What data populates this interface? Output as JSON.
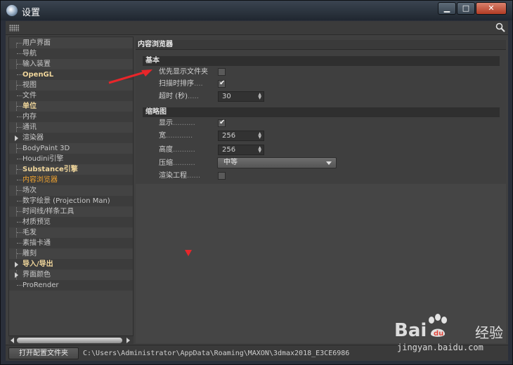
{
  "window": {
    "title": "设置"
  },
  "sidebar": {
    "items": [
      {
        "label": "用户界面",
        "bold": false,
        "selected": false,
        "expandable": false
      },
      {
        "label": "导航",
        "bold": false,
        "selected": false,
        "expandable": false
      },
      {
        "label": "输入装置",
        "bold": false,
        "selected": false,
        "expandable": false
      },
      {
        "label": "OpenGL",
        "bold": true,
        "selected": false,
        "expandable": false
      },
      {
        "label": "视图",
        "bold": false,
        "selected": false,
        "expandable": false
      },
      {
        "label": "文件",
        "bold": false,
        "selected": false,
        "expandable": false
      },
      {
        "label": "单位",
        "bold": true,
        "selected": false,
        "expandable": false
      },
      {
        "label": "内存",
        "bold": false,
        "selected": false,
        "expandable": false
      },
      {
        "label": "通讯",
        "bold": false,
        "selected": false,
        "expandable": false
      },
      {
        "label": "渲染器",
        "bold": false,
        "selected": false,
        "expandable": true
      },
      {
        "label": "BodyPaint 3D",
        "bold": false,
        "selected": false,
        "expandable": false
      },
      {
        "label": "Houdini引擎",
        "bold": false,
        "selected": false,
        "expandable": false
      },
      {
        "label": "Substance引擎",
        "bold": true,
        "selected": false,
        "expandable": false
      },
      {
        "label": "内容浏览器",
        "bold": false,
        "selected": true,
        "expandable": false
      },
      {
        "label": "场次",
        "bold": false,
        "selected": false,
        "expandable": false
      },
      {
        "label": "数字绘景 (Projection Man)",
        "bold": false,
        "selected": false,
        "expandable": false
      },
      {
        "label": "时间线/样条工具",
        "bold": false,
        "selected": false,
        "expandable": false
      },
      {
        "label": "材质预览",
        "bold": false,
        "selected": false,
        "expandable": false
      },
      {
        "label": "毛发",
        "bold": false,
        "selected": false,
        "expandable": false
      },
      {
        "label": "素描卡通",
        "bold": false,
        "selected": false,
        "expandable": false
      },
      {
        "label": "雕刻",
        "bold": false,
        "selected": false,
        "expandable": false
      },
      {
        "label": "导入/导出",
        "bold": true,
        "selected": false,
        "expandable": true
      },
      {
        "label": "界面颜色",
        "bold": false,
        "selected": false,
        "expandable": true
      },
      {
        "label": "ProRender",
        "bold": false,
        "selected": false,
        "expandable": false
      }
    ]
  },
  "main": {
    "panel_title": "内容浏览器",
    "basic": {
      "title": "基本",
      "show_folders_first": {
        "label": "优先显示文件夹",
        "checked": false
      },
      "sort_on_scan": {
        "label": "扫描时排序",
        "dots": "....",
        "checked": true
      },
      "timeout": {
        "label": "超时 (秒)",
        "dots": ".....",
        "value": "30"
      }
    },
    "thumbnail": {
      "title": "缩略图",
      "show": {
        "label": "显示",
        "dots": "..........",
        "checked": true
      },
      "width": {
        "label": "宽",
        "dots": "............",
        "value": "256"
      },
      "height": {
        "label": "高度",
        "dots": "..........",
        "value": "256"
      },
      "compression": {
        "label": "压缩",
        "dots": "..........",
        "value": "中等"
      },
      "render_project": {
        "label": "渲染工程",
        "dots": "......",
        "checked": false
      }
    }
  },
  "status": {
    "open_config_label": "打开配置文件夹",
    "path": "C:\\Users\\Administrator\\AppData\\Roaming\\MAXON\\3dmax2018_E3CE6986"
  },
  "watermark": {
    "brand_left": "Bai",
    "brand_right": "经验",
    "url": "jingyan.baidu.com"
  },
  "colors": {
    "selected_item": "#f2a42f",
    "bold_item": "#f0d69b",
    "annotation": "#e8262a"
  }
}
